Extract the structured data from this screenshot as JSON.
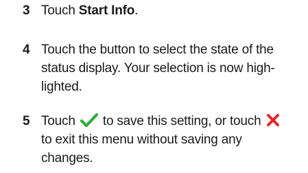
{
  "steps": [
    {
      "number": "3",
      "text_prefix": "Touch ",
      "strong": "Start Info",
      "text_suffix": "."
    },
    {
      "number": "4",
      "lines": [
        "Touch the button to select the state of the",
        "status display. Your selection is now high-",
        "lighted."
      ]
    },
    {
      "number": "5",
      "line1_a": "Touch ",
      "line1_b": " to save this setting, or touch ",
      "line2": "to exit this menu without saving any",
      "line3": "changes.",
      "icons": {
        "confirm": "check-icon",
        "cancel": "close-icon"
      },
      "colors": {
        "check": "#2fae3a",
        "close": "#e8242a"
      }
    }
  ]
}
